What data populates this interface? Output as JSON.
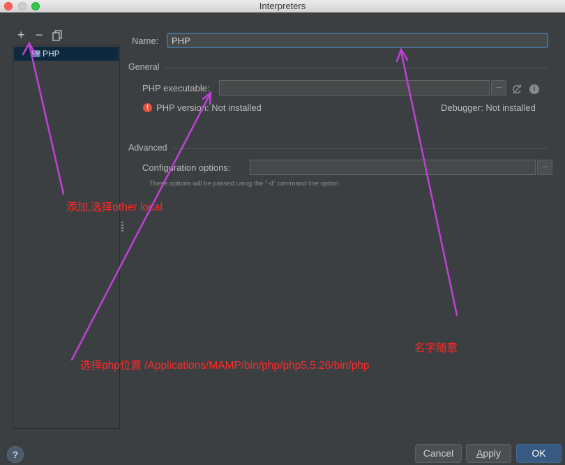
{
  "window": {
    "title": "Interpreters"
  },
  "toolbar": {
    "add": "+",
    "remove": "−"
  },
  "interpreter_list": {
    "items": [
      {
        "label": "PHP",
        "badge": "php"
      }
    ]
  },
  "form": {
    "name_label": "Name:",
    "name_value": "PHP",
    "general_section": "General",
    "php_executable_label": "PHP executable:",
    "php_executable_value": "",
    "browse_label": "...",
    "php_version_text": "PHP version: Not installed",
    "debugger_text": "Debugger: Not installed",
    "advanced_section": "Advanced",
    "config_options_label": "Configuration options:",
    "config_options_value": "",
    "config_hint": "These options will be passed using the \"-d\" command line option"
  },
  "footer": {
    "help": "?",
    "cancel": "Cancel",
    "apply_first": "A",
    "apply_rest": "pply",
    "ok": "OK"
  },
  "annotations": {
    "add_note": "添加,选择other local",
    "path_note": "选择php位置 /Applications/MAMP/bin/php/php5.5.26/bin/php",
    "name_note": "名字随意"
  },
  "colors": {
    "background": "#3c3f41",
    "accent": "#375a82",
    "annotation": "#ff2a2a",
    "arrow": "#c040d8",
    "error": "#e0523f"
  }
}
